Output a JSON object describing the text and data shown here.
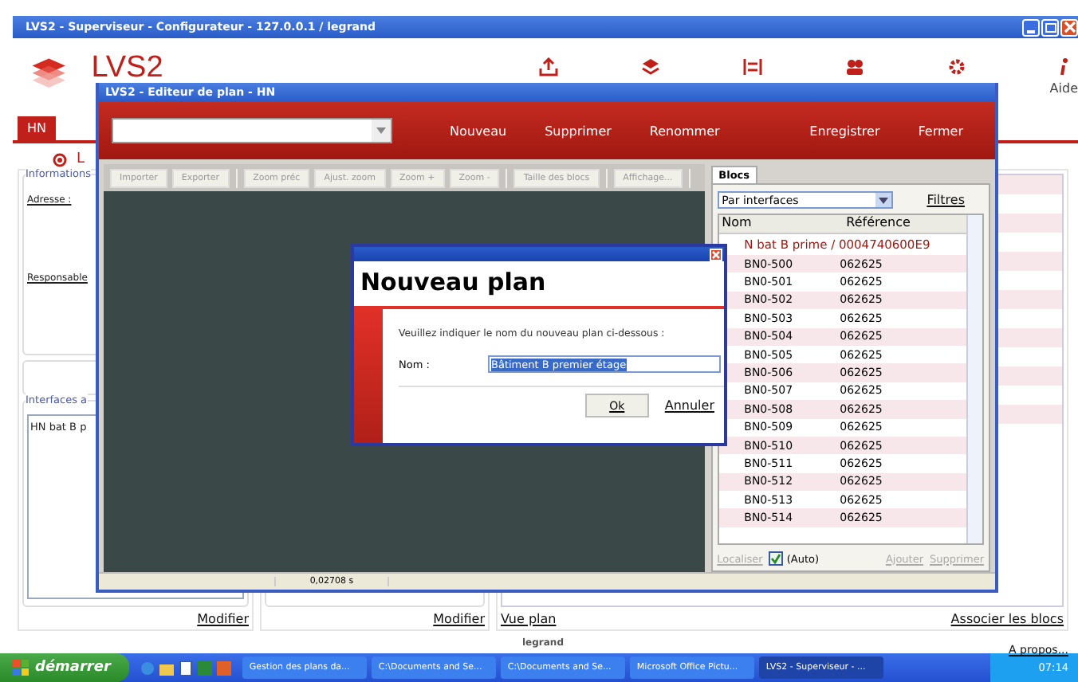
{
  "main_window": {
    "title": "LVS2 - Superviseur - Configurateur - 127.0.0.1 / legrand",
    "app_name": "LVS**2**",
    "nav_items": [
      {
        "kind": "upload"
      },
      {
        "kind": "layers"
      },
      {
        "kind": "sliders"
      },
      {
        "kind": "users"
      },
      {
        "kind": "gear"
      },
      {
        "kind": "info",
        "label": "Aide"
      }
    ],
    "tabs": [
      {
        "label": "HN",
        "selected": true
      }
    ],
    "heading": "L",
    "info_panel": {
      "title": "Informations",
      "fields": [
        "Adresse :",
        "Responsable"
      ]
    },
    "interfaces_panel": {
      "title": "Interfaces a",
      "items": [
        "HN bat B p"
      ]
    },
    "links": {
      "left": "Modifier",
      "middle": "Modifier",
      "view": "Vue plan",
      "associate": "Associer les blocs"
    },
    "footer": {
      "brand": "legrand",
      "about": "A propos..."
    }
  },
  "editor": {
    "title": "LVS2 - Editeur de plan - HN",
    "actions_left": [
      "Nouveau",
      "Supprimer",
      "Renommer"
    ],
    "actions_right": [
      "Enregistrer",
      "Fermer"
    ],
    "toolbar_groups": [
      [
        "Importer",
        "Exporter"
      ],
      [
        "Zoom préc",
        "Ajust. zoom",
        "Zoom +",
        "Zoom -"
      ],
      [
        "Taille des blocs"
      ],
      [
        "Affichage..."
      ]
    ],
    "status": "0,02708 s",
    "blocks": {
      "tab": "Blocs",
      "filter": "Par interfaces",
      "filters_link": "Filtres",
      "columns": [
        "Nom",
        "Référence"
      ],
      "group": "N bat B prime / 0004740600E9",
      "rows": [
        {
          "name": "BN0-500",
          "ref": "062625"
        },
        {
          "name": "BN0-501",
          "ref": "062625"
        },
        {
          "name": "BN0-502",
          "ref": "062625"
        },
        {
          "name": "BN0-503",
          "ref": "062625"
        },
        {
          "name": "BN0-504",
          "ref": "062625"
        },
        {
          "name": "BN0-505",
          "ref": "062625"
        },
        {
          "name": "BN0-506",
          "ref": "062625"
        },
        {
          "name": "BN0-507",
          "ref": "062625"
        },
        {
          "name": "BN0-508",
          "ref": "062625"
        },
        {
          "name": "BN0-509",
          "ref": "062625"
        },
        {
          "name": "BN0-510",
          "ref": "062625"
        },
        {
          "name": "BN0-511",
          "ref": "062625"
        },
        {
          "name": "BN0-512",
          "ref": "062625"
        },
        {
          "name": "BN0-513",
          "ref": "062625"
        },
        {
          "name": "BN0-514",
          "ref": "062625"
        }
      ],
      "locate": {
        "label": "Localiser",
        "disabled": true
      },
      "auto": {
        "label": "(Auto)",
        "checked": true
      },
      "add": {
        "label": "Ajouter",
        "disabled": true
      },
      "remove": {
        "label": "Supprimer",
        "disabled": true
      }
    }
  },
  "dialog": {
    "heading": "Nouveau plan",
    "prompt": "Veuillez indiquer le nom du nouveau plan ci-dessous :",
    "field_label": "Nom :",
    "field_value": "Bâtiment B premier étage",
    "ok": "Ok",
    "cancel": "Annuler"
  },
  "taskbar": {
    "start": "démarrer",
    "tasks": [
      {
        "label": "Gestion des plans da...",
        "selected": false
      },
      {
        "label": "C:\\Documents and Se...",
        "selected": false
      },
      {
        "label": "C:\\Documents and Se...",
        "selected": false
      },
      {
        "label": "Microsoft Office Pictu...",
        "selected": false
      },
      {
        "label": "LVS2 - Superviseur - ...",
        "selected": true
      }
    ],
    "clock": "07:14"
  }
}
